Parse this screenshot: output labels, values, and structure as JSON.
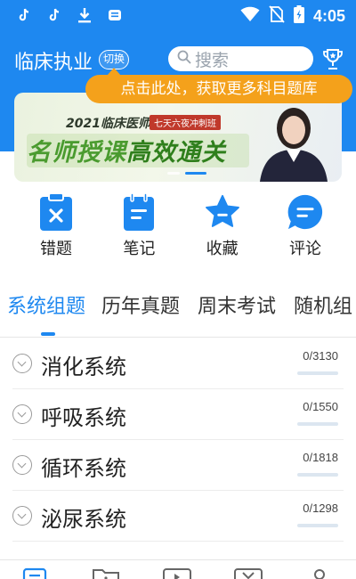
{
  "status_bar": {
    "time": "4:05",
    "left_icons": [
      "tiktok-icon",
      "tiktok-icon",
      "download-icon",
      "message-icon"
    ],
    "right_icons": [
      "wifi-icon",
      "no-sim-icon",
      "battery-charging-icon"
    ]
  },
  "header": {
    "title": "临床执业",
    "switch_label": "切换",
    "search_placeholder": "搜索",
    "trophy_icon": "trophy-icon"
  },
  "tooltip": {
    "text": "点击此处，获取更多科目题库"
  },
  "banner": {
    "line1": "2021临床医师",
    "tag": "七天六夜冲刺班",
    "line2_a": "名师授课",
    "line2_b": "高效通关",
    "slide_count": 3,
    "active_slide": 2
  },
  "actions": [
    {
      "label": "错题",
      "icon": "clipboard-x-icon"
    },
    {
      "label": "笔记",
      "icon": "notepad-icon"
    },
    {
      "label": "收藏",
      "icon": "star-icon"
    },
    {
      "label": "评论",
      "icon": "comment-icon"
    }
  ],
  "tabs": [
    {
      "label": "系统组题",
      "active": true
    },
    {
      "label": "历年真题",
      "active": false
    },
    {
      "label": "周末考试",
      "active": false
    },
    {
      "label": "随机组",
      "active": false
    }
  ],
  "systems": [
    {
      "name": "消化系统",
      "count": "0/3130"
    },
    {
      "name": "呼吸系统",
      "count": "0/1550"
    },
    {
      "name": "循环系统",
      "count": "0/1818"
    },
    {
      "name": "泌尿系统",
      "count": "0/1298"
    }
  ],
  "bottom_nav": [
    {
      "icon": "question-bank-icon",
      "active": true
    },
    {
      "icon": "folder-icon",
      "active": false
    },
    {
      "icon": "video-icon",
      "active": false
    },
    {
      "icon": "exam-icon",
      "active": false
    },
    {
      "icon": "profile-icon",
      "active": false
    }
  ],
  "colors": {
    "primary": "#1e88f0",
    "tooltip": "#f4a11b",
    "banner_green": "#3f8f22"
  }
}
